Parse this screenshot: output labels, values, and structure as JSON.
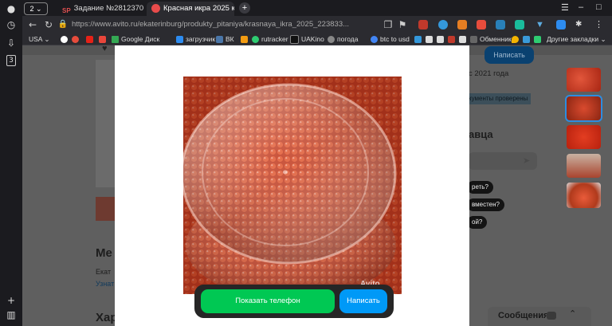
{
  "browser": {
    "tab_count": "2",
    "tabs": [
      {
        "title": "Задание №2812370 - про",
        "favicon": "SP"
      },
      {
        "title": "Красная икра 2025 куп"
      }
    ],
    "new_tab_icon": "+",
    "url": "https://www.avito.ru/ekaterinburg/produkty_pitaniya/krasnaya_ikra_2025_223833..."
  },
  "bookmarks": {
    "lang": "USA",
    "items": [
      "Google Диск",
      "загрузчик",
      "ВК",
      "rutracker",
      "UAKino",
      "погода",
      "btc to usd",
      "Обменник"
    ],
    "other": "Другие закладки"
  },
  "background_page": {
    "header_write_button": "Написать",
    "since_text": "с 2021 года",
    "verified_text": "кументы проверены",
    "seller_heading": "авца",
    "chips": [
      "реть?",
      "вместен?",
      "ой?"
    ],
    "section_heading_1": "Ме",
    "address_fragment": "Екат",
    "link_fragment": "Узнат",
    "section_heading_2": "Хар",
    "messages_label": "Сообщения"
  },
  "modal": {
    "show_phone_label": "Показать телефон",
    "write_label": "Написать",
    "watermark": "Avito"
  },
  "colors": {
    "green": "#00c853",
    "blue": "#0099f7",
    "caviar": "#c8391c"
  }
}
